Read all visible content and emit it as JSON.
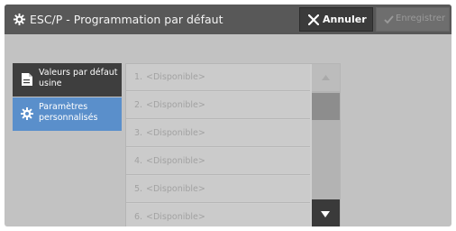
{
  "header": {
    "title": "ESC/P - Programmation par défaut",
    "cancel_label": "Annuler",
    "save_label": "Enregistrer"
  },
  "sidebar": {
    "items": [
      {
        "label": "Valeurs par défaut usine",
        "icon": "document-icon",
        "selected": false
      },
      {
        "label": "Paramètres personnalisés",
        "icon": "gear-icon",
        "selected": true
      }
    ]
  },
  "list": {
    "items": [
      {
        "number": "1.",
        "label": "<Disponible>"
      },
      {
        "number": "2.",
        "label": "<Disponible>"
      },
      {
        "number": "3.",
        "label": "<Disponible>"
      },
      {
        "number": "4.",
        "label": "<Disponible>"
      },
      {
        "number": "5.",
        "label": "<Disponible>"
      },
      {
        "number": "6.",
        "label": "<Disponible>"
      }
    ]
  },
  "colors": {
    "titlebar": "#585858",
    "selected_accent": "#5a8fcb",
    "background": "#c2c2c2"
  }
}
